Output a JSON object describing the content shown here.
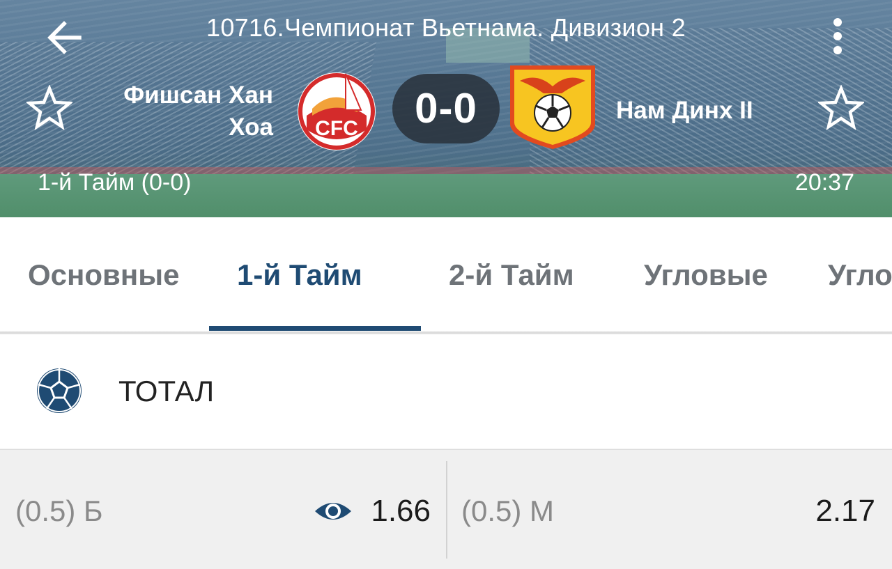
{
  "header": {
    "title": "10716.Чемпионат Вьетнама. Дивизион 2",
    "back_icon": "arrow-left-icon",
    "menu_icon": "more-vertical-icon"
  },
  "match": {
    "home_team": "Фишсан Хан Хоа",
    "away_team": "Нам Динх II",
    "score": "0-0",
    "period": "1-й  Тайм (0-0)",
    "time": "20:37",
    "home_logo_text": "CFC",
    "home_logo_icon": "club-crest-cfc-icon",
    "away_logo_icon": "club-crest-eagle-ball-icon",
    "favorite_icon": "star-outline-icon"
  },
  "tabs": [
    {
      "label": "Основные"
    },
    {
      "label": "1-й  Тайм"
    },
    {
      "label": "2-й  Тайм"
    },
    {
      "label": "Угловые"
    },
    {
      "label": "Угло"
    }
  ],
  "active_tab_index": 1,
  "market": {
    "title": "ТОТАЛ",
    "icon": "soccer-ball-icon",
    "outcomes": [
      {
        "label": "(0.5) Б",
        "odds": "1.66",
        "icon": "eye-icon"
      },
      {
        "label": "(0.5) М",
        "odds": "2.17"
      }
    ]
  },
  "colors": {
    "accent": "#1f4b73",
    "tab_inactive": "#6e7378",
    "odds_bg": "#f0f0f0"
  }
}
